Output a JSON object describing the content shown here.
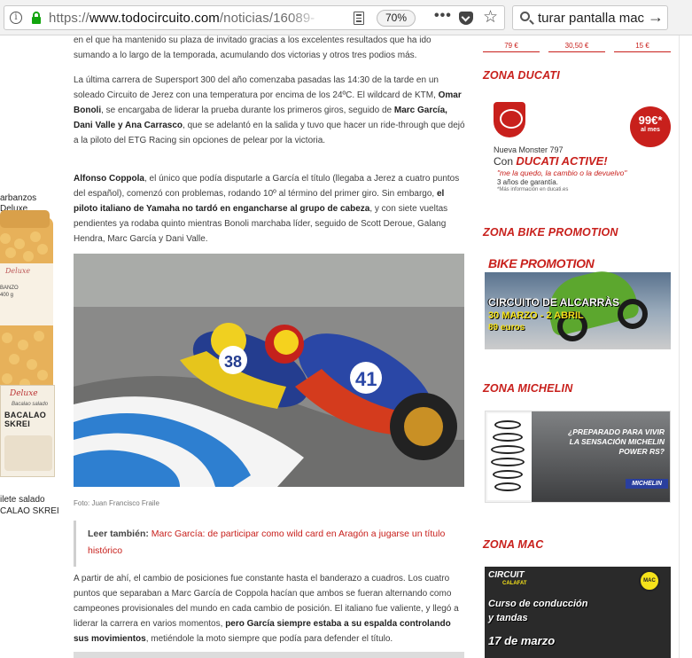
{
  "browser": {
    "url_protocol": "https://",
    "url_host": "www.todocircuito.com",
    "url_path": "/noticias/16089-",
    "zoom": "70%",
    "search_query": "turar pantalla mac"
  },
  "left_ad": {
    "text_top_1": "arbanzos",
    "text_top_2": "Deluxe",
    "jar_brand": "Deluxe",
    "jar_text": "BANZO\n400 g",
    "box_brand": "Deluxe",
    "box_sub": "Bacalao salado",
    "box_name_1": "BACALAO",
    "box_name_2": "SKREI",
    "text_bottom_1": "ilete salado",
    "text_bottom_2": "CALAO SKREI"
  },
  "article": {
    "p0": "en el que ha mantenido su plaza de invitado gracias a los excelentes resultados que ha ido sumando a lo largo de la temporada, acumulando dos victorias y otros tres podios más.",
    "p1_a": "La última carrera de Supersport 300 del año comenzaba pasadas las 14:30 de la tarde en un soleado Circuito de Jerez con una temperatura por encima de los 24ºC. El wildcard de KTM, ",
    "p1_b": "Omar Bonoli",
    "p1_c": ", se encargaba de liderar la prueba durante los primeros giros, seguido de ",
    "p1_d": "Marc García, Dani Valle y Ana Carrasco",
    "p1_e": ", que se adelantó en la salida y tuvo que hacer un ride-through que dejó a la piloto del ETG Racing sin opciones de pelear por la victoria.",
    "p2_a": "Alfonso Coppola",
    "p2_b": ", el único que podía disputarle a García el título (llegaba a Jerez a cuatro puntos del español), comenzó con problemas, rodando 10º al término del primer giro. Sin embargo, ",
    "p2_c": "el piloto italiano de Yamaha no tardó en engancharse al grupo de cabeza",
    "p2_d": ", y con siete vueltas pendientes ya rodaba quinto mientras Bonoli marchaba líder, seguido de Scott Deroue, Galang Hendra, Marc García y Dani Valle.",
    "photo_caption": "Foto: Juan Francisco Fraile",
    "read_also_label": "Leer también:",
    "read_also_link": "Marc García: de participar como wild card en Aragón a jugarse un título histórico",
    "p3_a": "A partir de ahí, el cambio de posiciones fue constante hasta el banderazo a cuadros. Los cuatro puntos que separaban a Marc García de Coppola hacían que ambos se fueran alternando como campeones provisionales del mundo en cada cambio de posición. El italiano fue valiente, y llegó a liderar la carrera en varios momentos, ",
    "p3_b": "pero García siempre estaba a su espalda controlando sus movimientos",
    "p3_c": ", metiéndole la moto siempre que podía para defender el título."
  },
  "sidebar": {
    "prices": [
      "79 €",
      "30,50 €",
      "15 €"
    ],
    "zone_ducati": "ZONA DUCATI",
    "ducati_price": "99€*",
    "ducati_price_sub": "al mes",
    "ducati_l1": "Nueva Monster 797",
    "ducati_l2_pre": "Con ",
    "ducati_l2_brand": "DUCATI ACTIVE!",
    "ducati_l3": "\"me la quedo, la cambio o la devuelvo\"",
    "ducati_l4": "3 años de garantía.",
    "ducati_l5": "*Más información en ducati.es",
    "zone_bike": "ZONA BIKE PROMOTION",
    "bike_brand": "BIKE PROMOTION",
    "bike_c1": "CIRCUITO DE ALCARRÀS",
    "bike_c2": "30 MARZO - 2 ABRIL",
    "bike_c3": "89 euros",
    "zone_michelin": "ZONA MICHELIN",
    "michelin_text": "¿PREPARADO PARA VIVIR LA SENSACIÓN MICHELIN POWER RS?",
    "michelin_logo": "MICHELIN",
    "zone_mac": "ZONA MAC",
    "mac_logo": "CIRCUIT",
    "mac_logo_sub": "CALAFAT",
    "mac_badge": "MAC",
    "mac_l1": "Curso de conducción",
    "mac_l2": "y tandas",
    "mac_l3": "17 de marzo"
  }
}
